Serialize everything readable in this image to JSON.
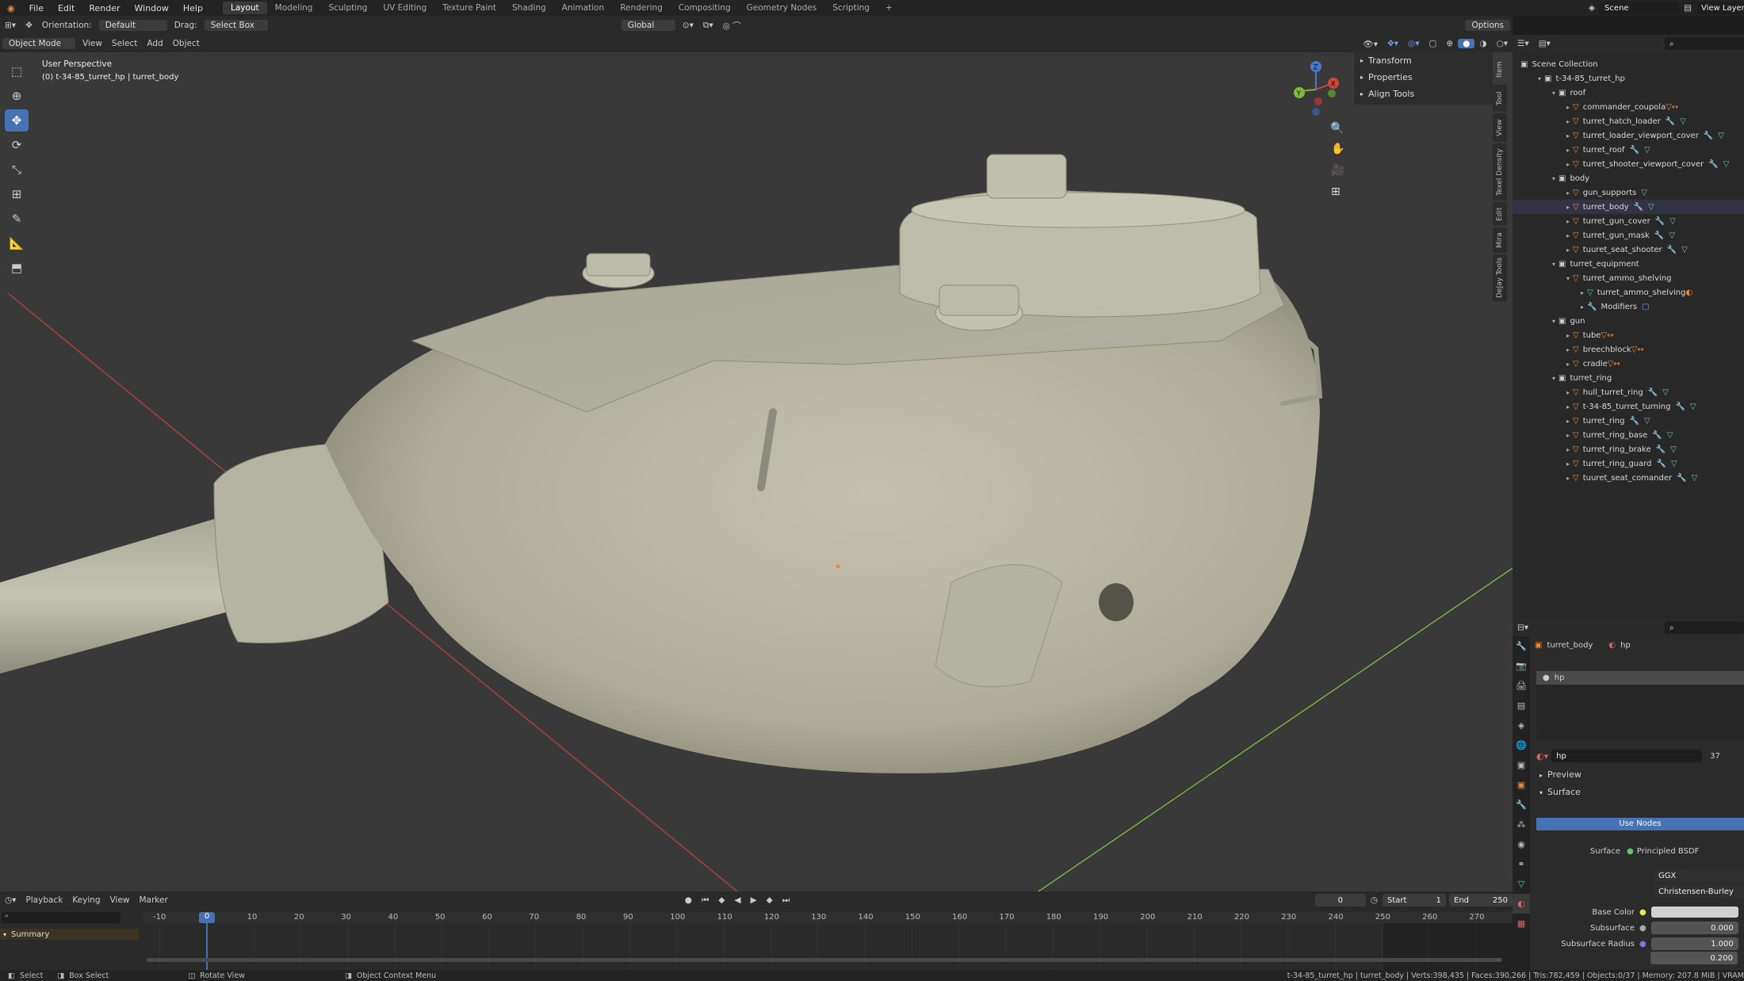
{
  "menu": [
    "File",
    "Edit",
    "Render",
    "Window",
    "Help"
  ],
  "workspaces": [
    "Layout",
    "Modeling",
    "Sculpting",
    "UV Editing",
    "Texture Paint",
    "Shading",
    "Animation",
    "Rendering",
    "Compositing",
    "Geometry Nodes",
    "Scripting",
    "+"
  ],
  "topright": {
    "scene_label": "Scene",
    "view_layer_label": "View Layer"
  },
  "header": {
    "orientation_label": "Orientation:",
    "orientation_value": "Default",
    "drag_label": "Drag:",
    "drag_value": "Select Box",
    "transform_value": "Global",
    "options": "Options"
  },
  "vp_header": {
    "mode": "Object Mode",
    "menus": [
      "View",
      "Select",
      "Add",
      "Object"
    ]
  },
  "viewport": {
    "perspective": "User Perspective",
    "object_info": "(0) t-34-85_turret_hp | turret_body"
  },
  "npanel": {
    "items": [
      "Transform",
      "Properties",
      "Align Tools"
    ],
    "tabs": [
      "Item",
      "Tool",
      "View",
      "Texel Density",
      "Edit",
      "Mira",
      "DeJay Tools"
    ]
  },
  "outliner": {
    "root": "Scene Collection",
    "rows": [
      {
        "depth": 1,
        "type": "coll",
        "name": "t-34-85_turret_hp",
        "open": true
      },
      {
        "depth": 2,
        "type": "coll",
        "name": "roof",
        "open": true
      },
      {
        "depth": 3,
        "type": "obj",
        "name": "commander_coupola",
        "ico": "obj"
      },
      {
        "depth": 3,
        "type": "obj",
        "name": "turret_hatch_loader",
        "ico": "mod-mesh"
      },
      {
        "depth": 3,
        "type": "obj",
        "name": "turret_loader_viewport_cover",
        "ico": "mod-mesh"
      },
      {
        "depth": 3,
        "type": "obj",
        "name": "turret_roof",
        "ico": "mod-mesh"
      },
      {
        "depth": 3,
        "type": "obj",
        "name": "turret_shooter_viewport_cover",
        "ico": "mod-mesh"
      },
      {
        "depth": 2,
        "type": "coll",
        "name": "body",
        "open": true
      },
      {
        "depth": 3,
        "type": "obj",
        "name": "gun_supports",
        "ico": "mesh"
      },
      {
        "depth": 3,
        "type": "obj",
        "name": "turret_body",
        "ico": "mod-mesh"
      },
      {
        "depth": 3,
        "type": "obj",
        "name": "turret_gun_cover",
        "ico": "mod-mesh"
      },
      {
        "depth": 3,
        "type": "obj",
        "name": "turret_gun_mask",
        "ico": "mod-mesh"
      },
      {
        "depth": 3,
        "type": "obj",
        "name": "tuuret_seat_shooter",
        "ico": "mod-mesh"
      },
      {
        "depth": 2,
        "type": "coll",
        "name": "turret_equipment",
        "open": true
      },
      {
        "depth": 3,
        "type": "obj",
        "name": "turret_ammo_shelving",
        "ico": "none",
        "open": true
      },
      {
        "depth": 4,
        "type": "mesh",
        "name": "turret_ammo_shelving",
        "ico": "mat"
      },
      {
        "depth": 4,
        "type": "mod",
        "name": "Modifiers",
        "ico": "modbox"
      },
      {
        "depth": 2,
        "type": "coll",
        "name": "gun",
        "open": true
      },
      {
        "depth": 3,
        "type": "obj",
        "name": "tube",
        "ico": "obj"
      },
      {
        "depth": 3,
        "type": "obj",
        "name": "breechblock",
        "ico": "obj"
      },
      {
        "depth": 3,
        "type": "obj",
        "name": "cradle",
        "ico": "obj"
      },
      {
        "depth": 2,
        "type": "coll",
        "name": "turret_ring",
        "open": true
      },
      {
        "depth": 3,
        "type": "obj",
        "name": "hull_turret_ring",
        "ico": "mod-mesh"
      },
      {
        "depth": 3,
        "type": "obj",
        "name": "t-34-85_turret_turning",
        "ico": "mod-mesh"
      },
      {
        "depth": 3,
        "type": "obj",
        "name": "turret_ring",
        "ico": "mod-mesh"
      },
      {
        "depth": 3,
        "type": "obj",
        "name": "turret_ring_base",
        "ico": "mod-mesh"
      },
      {
        "depth": 3,
        "type": "obj",
        "name": "turret_ring_brake",
        "ico": "mod-mesh"
      },
      {
        "depth": 3,
        "type": "obj",
        "name": "turret_ring_guard",
        "ico": "mod-mesh"
      },
      {
        "depth": 3,
        "type": "obj",
        "name": "tuuret_seat_comander",
        "ico": "mod-mesh"
      }
    ]
  },
  "props": {
    "object": "turret_body",
    "material_crumb": "hp",
    "slot": "hp",
    "mat_name": "hp",
    "users": "37",
    "preview": "Preview",
    "surface_panel": "Surface",
    "use_nodes": "Use Nodes",
    "surface_label": "Surface",
    "surface_value": "Principled BSDF",
    "dist": "GGX",
    "ss_method": "Christensen-Burley",
    "base_color_label": "Base Color",
    "subsurface_label": "Subsurface",
    "subsurface_value": "0.000",
    "ss_radius_label": "Subsurface Radius",
    "ss_radius_1": "1.000",
    "ss_radius_2": "0.200"
  },
  "timeline": {
    "menus": [
      "Playback",
      "Keying",
      "View",
      "Marker"
    ],
    "current": "0",
    "start_label": "Start",
    "start": "1",
    "end_label": "End",
    "end": "250",
    "ticks": [
      "-10",
      "0",
      "10",
      "20",
      "30",
      "40",
      "50",
      "60",
      "70",
      "80",
      "90",
      "100",
      "110",
      "120",
      "130",
      "140",
      "150",
      "160",
      "170",
      "180",
      "190",
      "200",
      "210",
      "220",
      "230",
      "240",
      "250",
      "260",
      "270"
    ],
    "summary": "Summary"
  },
  "status": {
    "select": "Select",
    "box": "Box Select",
    "rotate": "Rotate View",
    "context": "Object Context Menu",
    "stats": "t-34-85_turret_hp | turret_body | Verts:398,435 | Faces:390,266 | Tris:782,459 | Objects:0/37 | Memory: 207.8 MiB | VRAM"
  },
  "colors": {
    "accent": "#4772b3",
    "viewport": "#393939",
    "model": "#b9b8a5",
    "axis_x": "#c03a3a",
    "axis_y": "#7fb83a"
  }
}
